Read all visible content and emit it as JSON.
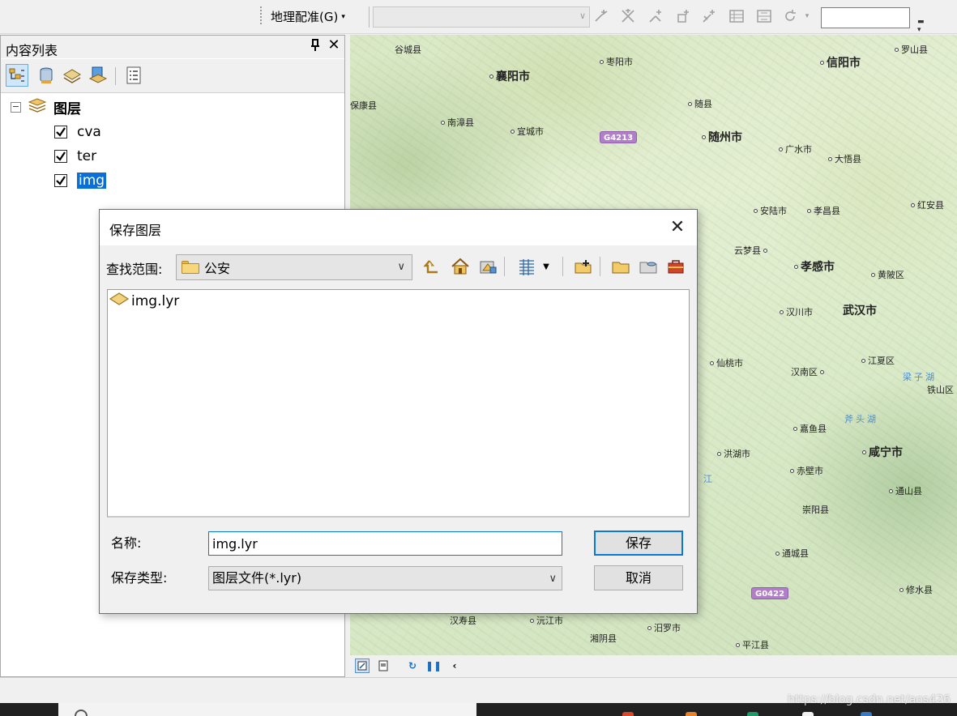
{
  "toolbar": {
    "georef_label": "地理配准(G)",
    "georef_arrow": "▾",
    "layer_combo_value": "",
    "text_box_value": "",
    "icons": [
      "add-control-points-icon",
      "link-table-points-icon",
      "rotate-points-icon",
      "shift-points-icon",
      "scale-points-icon",
      "view-link-table-icon",
      "view-registration-icon",
      "auto-adjust-icon"
    ]
  },
  "toc": {
    "title": "内容列表",
    "pin_glyph": "ᵖ",
    "close_glyph": "✕",
    "root_label": "图层",
    "root_expander": "⊟",
    "layers": [
      {
        "name": "cva",
        "checked": true
      },
      {
        "name": "ter",
        "checked": true
      },
      {
        "name": "img",
        "checked": true,
        "selected": true
      }
    ]
  },
  "map": {
    "places": [
      {
        "name": "谷城县",
        "kind": "county"
      },
      {
        "name": "枣阳市",
        "kind": "county"
      },
      {
        "name": "信阳市",
        "kind": "city"
      },
      {
        "name": "罗山县",
        "kind": "county"
      },
      {
        "name": "襄阳市",
        "kind": "city"
      },
      {
        "name": "保康县",
        "kind": "county"
      },
      {
        "name": "随县",
        "kind": "county"
      },
      {
        "name": "南漳县",
        "kind": "county"
      },
      {
        "name": "宜城市",
        "kind": "county"
      },
      {
        "name": "随州市",
        "kind": "city"
      },
      {
        "name": "广水市",
        "kind": "county"
      },
      {
        "name": "大悟县",
        "kind": "county"
      },
      {
        "name": "安陆市",
        "kind": "county"
      },
      {
        "name": "孝昌县",
        "kind": "county"
      },
      {
        "name": "红安县",
        "kind": "county"
      },
      {
        "name": "云梦县",
        "kind": "county"
      },
      {
        "name": "孝感市",
        "kind": "city"
      },
      {
        "name": "黄陂区",
        "kind": "county"
      },
      {
        "name": "汉川市",
        "kind": "county"
      },
      {
        "name": "武汉市",
        "kind": "city"
      },
      {
        "name": "仙桃市",
        "kind": "county"
      },
      {
        "name": "汉南区",
        "kind": "county"
      },
      {
        "name": "江夏区",
        "kind": "county"
      },
      {
        "name": "梁子湖",
        "kind": "water"
      },
      {
        "name": "铁山区",
        "kind": "county"
      },
      {
        "name": "斧头湖",
        "kind": "water"
      },
      {
        "name": "嘉鱼县",
        "kind": "county"
      },
      {
        "name": "洪湖市",
        "kind": "county"
      },
      {
        "name": "咸宁市",
        "kind": "city"
      },
      {
        "name": "赤壁市",
        "kind": "county"
      },
      {
        "name": "通山县",
        "kind": "county"
      },
      {
        "name": "崇阳县",
        "kind": "county"
      },
      {
        "name": "通城县",
        "kind": "county"
      },
      {
        "name": "修水县",
        "kind": "county"
      },
      {
        "name": "汉寿县",
        "kind": "county"
      },
      {
        "name": "沅江市",
        "kind": "county"
      },
      {
        "name": "汨罗市",
        "kind": "county"
      },
      {
        "name": "湘阴县",
        "kind": "county"
      },
      {
        "name": "平江县",
        "kind": "county"
      },
      {
        "name": "江",
        "kind": "water"
      }
    ],
    "road_shields": [
      "G4213",
      "G0422"
    ],
    "status_icons": [
      "layout-view-icon",
      "data-view-icon",
      "refresh-icon",
      "pause-drawing-icon",
      "collapse-icon"
    ]
  },
  "dialog": {
    "title": "保存图层",
    "close_glyph": "✕",
    "lookin_label": "查找范围:",
    "lookin_value": "公安",
    "files": [
      {
        "name": "img.lyr",
        "icon": "layer-file-icon"
      }
    ],
    "name_label": "名称:",
    "name_value": "img.lyr",
    "type_label": "保存类型:",
    "type_value": "图层文件(*.lyr)",
    "save_label": "保存",
    "cancel_label": "取消",
    "dropdown_glyph": "∨"
  },
  "watermark": "https://blog.csdn.net/aos426"
}
